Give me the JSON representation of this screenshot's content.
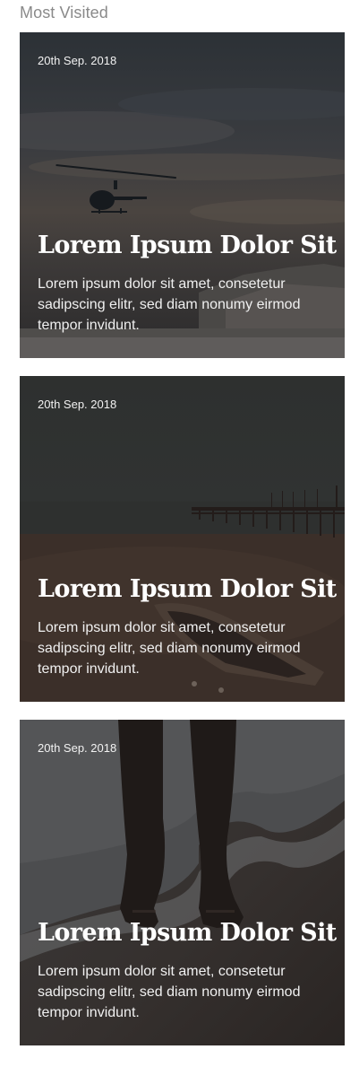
{
  "section": {
    "title": "Most Visited"
  },
  "cards": [
    {
      "date": "20th Sep. 2018",
      "title": "Lorem Ipsum Dolor Sit",
      "excerpt": "Lorem ipsum dolor sit amet, consetetur sadipscing elitr, sed diam nonumy eirmod tempor invidunt.",
      "image": "helicopter-over-beach-photo"
    },
    {
      "date": "20th Sep. 2018",
      "title": "Lorem Ipsum Dolor Sit",
      "excerpt": "Lorem ipsum dolor sit amet, consetetur sadipscing elitr, sed diam nonumy eirmod tempor invidunt.",
      "image": "pier-and-boat-photo"
    },
    {
      "date": "20th Sep. 2018",
      "title": "Lorem Ipsum Dolor Sit",
      "excerpt": "Lorem ipsum dolor sit amet, consetetur sadipscing elitr, sed diam nonumy eirmod tempor invidunt.",
      "image": "feet-in-surf-photo"
    }
  ]
}
